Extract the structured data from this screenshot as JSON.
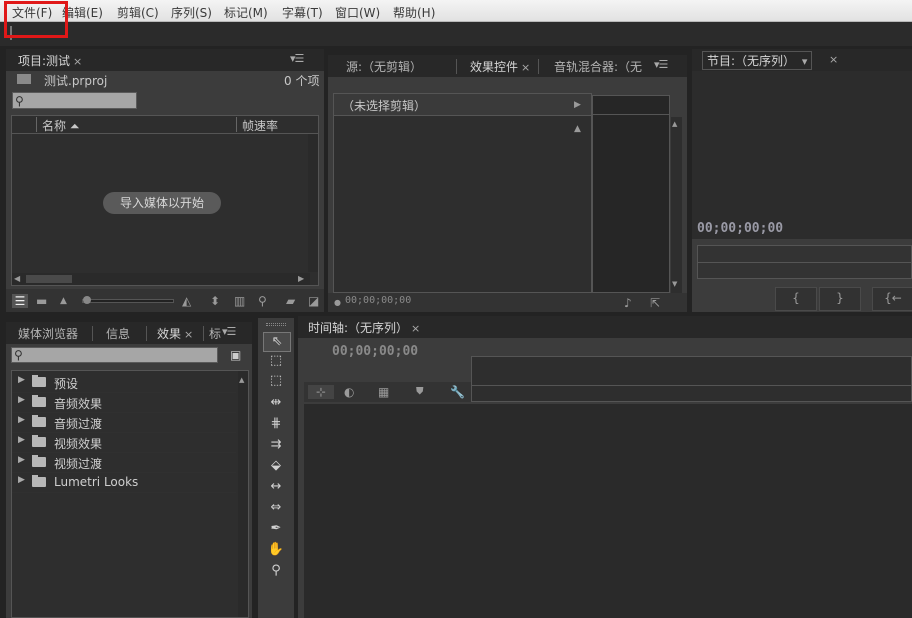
{
  "menu": {
    "items": [
      "文件(F)",
      "编辑(E)",
      "剪辑(C)",
      "序列(S)",
      "标记(M)",
      "字幕(T)",
      "窗口(W)",
      "帮助(H)"
    ],
    "highlighted": "文件(F)"
  },
  "project_panel": {
    "tab": "项目:测试",
    "file_name": "测试.prproj",
    "item_count": "0 个项",
    "col_name": "名称",
    "col_framerate": "帧速率",
    "import_hint": "导入媒体以开始"
  },
  "source_panel": {
    "tabs": [
      "源:（无剪辑）",
      "效果控件",
      "音轨混合器:（无"
    ],
    "active": "效果控件",
    "no_clip": "（未选择剪辑）",
    "timecode": "00;00;00;00"
  },
  "program_panel": {
    "tab": "节目:（无序列）",
    "timecode": "00;00;00;00"
  },
  "effects_panel": {
    "tabs": [
      "媒体浏览器",
      "信息",
      "效果",
      "标"
    ],
    "active": "效果",
    "items": [
      "预设",
      "音频效果",
      "音频过渡",
      "视频效果",
      "视频过渡",
      "Lumetri Looks"
    ]
  },
  "timeline_panel": {
    "tab": "时间轴:（无序列）",
    "timecode": "00;00;00;00"
  },
  "colors": {
    "highlight_box": "#e01818",
    "panel_bg": "#3c3c3c",
    "timecode": "#b8b8b8"
  }
}
